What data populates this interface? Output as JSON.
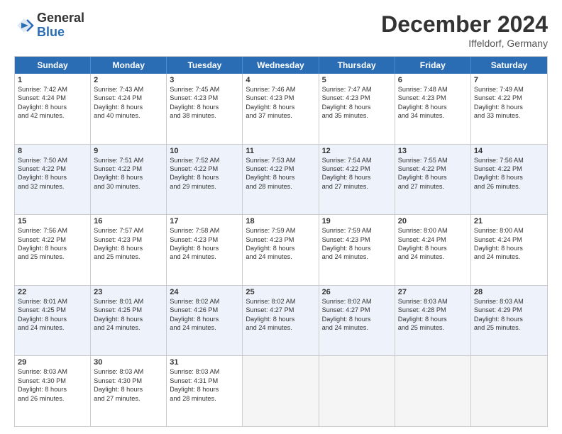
{
  "logo": {
    "general": "General",
    "blue": "Blue"
  },
  "title": "December 2024",
  "location": "Iffeldorf, Germany",
  "days": [
    "Sunday",
    "Monday",
    "Tuesday",
    "Wednesday",
    "Thursday",
    "Friday",
    "Saturday"
  ],
  "weeks": [
    [
      {
        "day": "1",
        "lines": [
          "Sunrise: 7:42 AM",
          "Sunset: 4:24 PM",
          "Daylight: 8 hours",
          "and 42 minutes."
        ],
        "empty": false,
        "alt": false
      },
      {
        "day": "2",
        "lines": [
          "Sunrise: 7:43 AM",
          "Sunset: 4:24 PM",
          "Daylight: 8 hours",
          "and 40 minutes."
        ],
        "empty": false,
        "alt": false
      },
      {
        "day": "3",
        "lines": [
          "Sunrise: 7:45 AM",
          "Sunset: 4:23 PM",
          "Daylight: 8 hours",
          "and 38 minutes."
        ],
        "empty": false,
        "alt": false
      },
      {
        "day": "4",
        "lines": [
          "Sunrise: 7:46 AM",
          "Sunset: 4:23 PM",
          "Daylight: 8 hours",
          "and 37 minutes."
        ],
        "empty": false,
        "alt": false
      },
      {
        "day": "5",
        "lines": [
          "Sunrise: 7:47 AM",
          "Sunset: 4:23 PM",
          "Daylight: 8 hours",
          "and 35 minutes."
        ],
        "empty": false,
        "alt": false
      },
      {
        "day": "6",
        "lines": [
          "Sunrise: 7:48 AM",
          "Sunset: 4:23 PM",
          "Daylight: 8 hours",
          "and 34 minutes."
        ],
        "empty": false,
        "alt": false
      },
      {
        "day": "7",
        "lines": [
          "Sunrise: 7:49 AM",
          "Sunset: 4:22 PM",
          "Daylight: 8 hours",
          "and 33 minutes."
        ],
        "empty": false,
        "alt": false
      }
    ],
    [
      {
        "day": "8",
        "lines": [
          "Sunrise: 7:50 AM",
          "Sunset: 4:22 PM",
          "Daylight: 8 hours",
          "and 32 minutes."
        ],
        "empty": false,
        "alt": true
      },
      {
        "day": "9",
        "lines": [
          "Sunrise: 7:51 AM",
          "Sunset: 4:22 PM",
          "Daylight: 8 hours",
          "and 30 minutes."
        ],
        "empty": false,
        "alt": true
      },
      {
        "day": "10",
        "lines": [
          "Sunrise: 7:52 AM",
          "Sunset: 4:22 PM",
          "Daylight: 8 hours",
          "and 29 minutes."
        ],
        "empty": false,
        "alt": true
      },
      {
        "day": "11",
        "lines": [
          "Sunrise: 7:53 AM",
          "Sunset: 4:22 PM",
          "Daylight: 8 hours",
          "and 28 minutes."
        ],
        "empty": false,
        "alt": true
      },
      {
        "day": "12",
        "lines": [
          "Sunrise: 7:54 AM",
          "Sunset: 4:22 PM",
          "Daylight: 8 hours",
          "and 27 minutes."
        ],
        "empty": false,
        "alt": true
      },
      {
        "day": "13",
        "lines": [
          "Sunrise: 7:55 AM",
          "Sunset: 4:22 PM",
          "Daylight: 8 hours",
          "and 27 minutes."
        ],
        "empty": false,
        "alt": true
      },
      {
        "day": "14",
        "lines": [
          "Sunrise: 7:56 AM",
          "Sunset: 4:22 PM",
          "Daylight: 8 hours",
          "and 26 minutes."
        ],
        "empty": false,
        "alt": true
      }
    ],
    [
      {
        "day": "15",
        "lines": [
          "Sunrise: 7:56 AM",
          "Sunset: 4:22 PM",
          "Daylight: 8 hours",
          "and 25 minutes."
        ],
        "empty": false,
        "alt": false
      },
      {
        "day": "16",
        "lines": [
          "Sunrise: 7:57 AM",
          "Sunset: 4:23 PM",
          "Daylight: 8 hours",
          "and 25 minutes."
        ],
        "empty": false,
        "alt": false
      },
      {
        "day": "17",
        "lines": [
          "Sunrise: 7:58 AM",
          "Sunset: 4:23 PM",
          "Daylight: 8 hours",
          "and 24 minutes."
        ],
        "empty": false,
        "alt": false
      },
      {
        "day": "18",
        "lines": [
          "Sunrise: 7:59 AM",
          "Sunset: 4:23 PM",
          "Daylight: 8 hours",
          "and 24 minutes."
        ],
        "empty": false,
        "alt": false
      },
      {
        "day": "19",
        "lines": [
          "Sunrise: 7:59 AM",
          "Sunset: 4:23 PM",
          "Daylight: 8 hours",
          "and 24 minutes."
        ],
        "empty": false,
        "alt": false
      },
      {
        "day": "20",
        "lines": [
          "Sunrise: 8:00 AM",
          "Sunset: 4:24 PM",
          "Daylight: 8 hours",
          "and 24 minutes."
        ],
        "empty": false,
        "alt": false
      },
      {
        "day": "21",
        "lines": [
          "Sunrise: 8:00 AM",
          "Sunset: 4:24 PM",
          "Daylight: 8 hours",
          "and 24 minutes."
        ],
        "empty": false,
        "alt": false
      }
    ],
    [
      {
        "day": "22",
        "lines": [
          "Sunrise: 8:01 AM",
          "Sunset: 4:25 PM",
          "Daylight: 8 hours",
          "and 24 minutes."
        ],
        "empty": false,
        "alt": true
      },
      {
        "day": "23",
        "lines": [
          "Sunrise: 8:01 AM",
          "Sunset: 4:25 PM",
          "Daylight: 8 hours",
          "and 24 minutes."
        ],
        "empty": false,
        "alt": true
      },
      {
        "day": "24",
        "lines": [
          "Sunrise: 8:02 AM",
          "Sunset: 4:26 PM",
          "Daylight: 8 hours",
          "and 24 minutes."
        ],
        "empty": false,
        "alt": true
      },
      {
        "day": "25",
        "lines": [
          "Sunrise: 8:02 AM",
          "Sunset: 4:27 PM",
          "Daylight: 8 hours",
          "and 24 minutes."
        ],
        "empty": false,
        "alt": true
      },
      {
        "day": "26",
        "lines": [
          "Sunrise: 8:02 AM",
          "Sunset: 4:27 PM",
          "Daylight: 8 hours",
          "and 24 minutes."
        ],
        "empty": false,
        "alt": true
      },
      {
        "day": "27",
        "lines": [
          "Sunrise: 8:03 AM",
          "Sunset: 4:28 PM",
          "Daylight: 8 hours",
          "and 25 minutes."
        ],
        "empty": false,
        "alt": true
      },
      {
        "day": "28",
        "lines": [
          "Sunrise: 8:03 AM",
          "Sunset: 4:29 PM",
          "Daylight: 8 hours",
          "and 25 minutes."
        ],
        "empty": false,
        "alt": true
      }
    ],
    [
      {
        "day": "29",
        "lines": [
          "Sunrise: 8:03 AM",
          "Sunset: 4:30 PM",
          "Daylight: 8 hours",
          "and 26 minutes."
        ],
        "empty": false,
        "alt": false
      },
      {
        "day": "30",
        "lines": [
          "Sunrise: 8:03 AM",
          "Sunset: 4:30 PM",
          "Daylight: 8 hours",
          "and 27 minutes."
        ],
        "empty": false,
        "alt": false
      },
      {
        "day": "31",
        "lines": [
          "Sunrise: 8:03 AM",
          "Sunset: 4:31 PM",
          "Daylight: 8 hours",
          "and 28 minutes."
        ],
        "empty": false,
        "alt": false
      },
      {
        "day": "",
        "lines": [],
        "empty": true,
        "alt": false
      },
      {
        "day": "",
        "lines": [],
        "empty": true,
        "alt": false
      },
      {
        "day": "",
        "lines": [],
        "empty": true,
        "alt": false
      },
      {
        "day": "",
        "lines": [],
        "empty": true,
        "alt": false
      }
    ]
  ]
}
